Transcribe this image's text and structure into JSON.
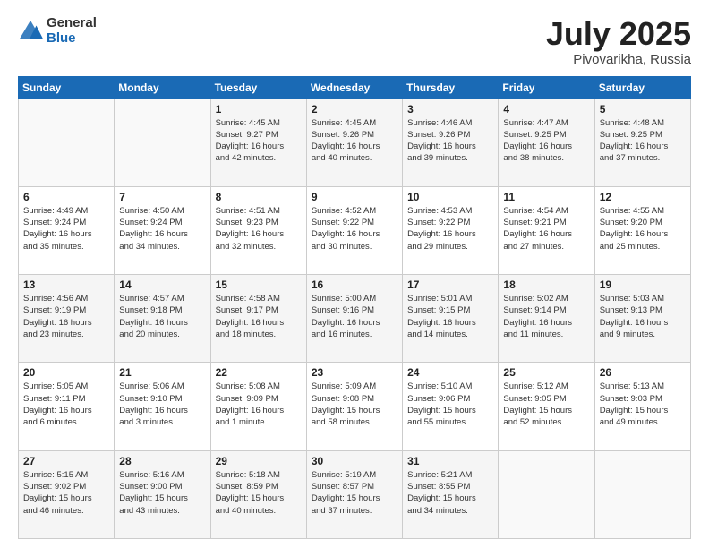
{
  "header": {
    "logo_general": "General",
    "logo_blue": "Blue",
    "title": "July 2025",
    "location": "Pivovarikha, Russia"
  },
  "weekdays": [
    "Sunday",
    "Monday",
    "Tuesday",
    "Wednesday",
    "Thursday",
    "Friday",
    "Saturday"
  ],
  "weeks": [
    [
      {
        "day": "",
        "info": ""
      },
      {
        "day": "",
        "info": ""
      },
      {
        "day": "1",
        "info": "Sunrise: 4:45 AM\nSunset: 9:27 PM\nDaylight: 16 hours\nand 42 minutes."
      },
      {
        "day": "2",
        "info": "Sunrise: 4:45 AM\nSunset: 9:26 PM\nDaylight: 16 hours\nand 40 minutes."
      },
      {
        "day": "3",
        "info": "Sunrise: 4:46 AM\nSunset: 9:26 PM\nDaylight: 16 hours\nand 39 minutes."
      },
      {
        "day": "4",
        "info": "Sunrise: 4:47 AM\nSunset: 9:25 PM\nDaylight: 16 hours\nand 38 minutes."
      },
      {
        "day": "5",
        "info": "Sunrise: 4:48 AM\nSunset: 9:25 PM\nDaylight: 16 hours\nand 37 minutes."
      }
    ],
    [
      {
        "day": "6",
        "info": "Sunrise: 4:49 AM\nSunset: 9:24 PM\nDaylight: 16 hours\nand 35 minutes."
      },
      {
        "day": "7",
        "info": "Sunrise: 4:50 AM\nSunset: 9:24 PM\nDaylight: 16 hours\nand 34 minutes."
      },
      {
        "day": "8",
        "info": "Sunrise: 4:51 AM\nSunset: 9:23 PM\nDaylight: 16 hours\nand 32 minutes."
      },
      {
        "day": "9",
        "info": "Sunrise: 4:52 AM\nSunset: 9:22 PM\nDaylight: 16 hours\nand 30 minutes."
      },
      {
        "day": "10",
        "info": "Sunrise: 4:53 AM\nSunset: 9:22 PM\nDaylight: 16 hours\nand 29 minutes."
      },
      {
        "day": "11",
        "info": "Sunrise: 4:54 AM\nSunset: 9:21 PM\nDaylight: 16 hours\nand 27 minutes."
      },
      {
        "day": "12",
        "info": "Sunrise: 4:55 AM\nSunset: 9:20 PM\nDaylight: 16 hours\nand 25 minutes."
      }
    ],
    [
      {
        "day": "13",
        "info": "Sunrise: 4:56 AM\nSunset: 9:19 PM\nDaylight: 16 hours\nand 23 minutes."
      },
      {
        "day": "14",
        "info": "Sunrise: 4:57 AM\nSunset: 9:18 PM\nDaylight: 16 hours\nand 20 minutes."
      },
      {
        "day": "15",
        "info": "Sunrise: 4:58 AM\nSunset: 9:17 PM\nDaylight: 16 hours\nand 18 minutes."
      },
      {
        "day": "16",
        "info": "Sunrise: 5:00 AM\nSunset: 9:16 PM\nDaylight: 16 hours\nand 16 minutes."
      },
      {
        "day": "17",
        "info": "Sunrise: 5:01 AM\nSunset: 9:15 PM\nDaylight: 16 hours\nand 14 minutes."
      },
      {
        "day": "18",
        "info": "Sunrise: 5:02 AM\nSunset: 9:14 PM\nDaylight: 16 hours\nand 11 minutes."
      },
      {
        "day": "19",
        "info": "Sunrise: 5:03 AM\nSunset: 9:13 PM\nDaylight: 16 hours\nand 9 minutes."
      }
    ],
    [
      {
        "day": "20",
        "info": "Sunrise: 5:05 AM\nSunset: 9:11 PM\nDaylight: 16 hours\nand 6 minutes."
      },
      {
        "day": "21",
        "info": "Sunrise: 5:06 AM\nSunset: 9:10 PM\nDaylight: 16 hours\nand 3 minutes."
      },
      {
        "day": "22",
        "info": "Sunrise: 5:08 AM\nSunset: 9:09 PM\nDaylight: 16 hours\nand 1 minute."
      },
      {
        "day": "23",
        "info": "Sunrise: 5:09 AM\nSunset: 9:08 PM\nDaylight: 15 hours\nand 58 minutes."
      },
      {
        "day": "24",
        "info": "Sunrise: 5:10 AM\nSunset: 9:06 PM\nDaylight: 15 hours\nand 55 minutes."
      },
      {
        "day": "25",
        "info": "Sunrise: 5:12 AM\nSunset: 9:05 PM\nDaylight: 15 hours\nand 52 minutes."
      },
      {
        "day": "26",
        "info": "Sunrise: 5:13 AM\nSunset: 9:03 PM\nDaylight: 15 hours\nand 49 minutes."
      }
    ],
    [
      {
        "day": "27",
        "info": "Sunrise: 5:15 AM\nSunset: 9:02 PM\nDaylight: 15 hours\nand 46 minutes."
      },
      {
        "day": "28",
        "info": "Sunrise: 5:16 AM\nSunset: 9:00 PM\nDaylight: 15 hours\nand 43 minutes."
      },
      {
        "day": "29",
        "info": "Sunrise: 5:18 AM\nSunset: 8:59 PM\nDaylight: 15 hours\nand 40 minutes."
      },
      {
        "day": "30",
        "info": "Sunrise: 5:19 AM\nSunset: 8:57 PM\nDaylight: 15 hours\nand 37 minutes."
      },
      {
        "day": "31",
        "info": "Sunrise: 5:21 AM\nSunset: 8:55 PM\nDaylight: 15 hours\nand 34 minutes."
      },
      {
        "day": "",
        "info": ""
      },
      {
        "day": "",
        "info": ""
      }
    ]
  ]
}
